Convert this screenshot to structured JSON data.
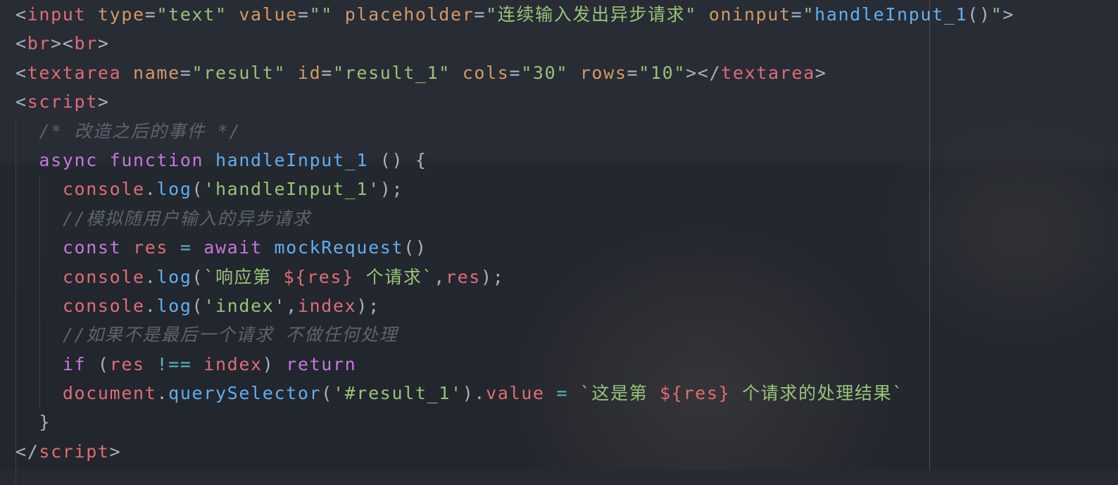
{
  "editor": {
    "colors": {
      "background": "#282c34",
      "tag": "#e06c75",
      "attribute": "#d19a66",
      "string": "#98c379",
      "keyword": "#c678dd",
      "function": "#61afef",
      "comment": "#5c6370",
      "punctuation": "#abb2bf",
      "operator": "#56b6c2"
    },
    "lines": [
      {
        "indent": 0,
        "tokens": [
          [
            "p",
            "<"
          ],
          [
            "t",
            "input"
          ],
          [
            "p",
            " "
          ],
          [
            "a",
            "type"
          ],
          [
            "p",
            "="
          ],
          [
            "s",
            "\"text\""
          ],
          [
            "p",
            " "
          ],
          [
            "a",
            "value"
          ],
          [
            "p",
            "="
          ],
          [
            "s",
            "\"\""
          ],
          [
            "p",
            " "
          ],
          [
            "a",
            "placeholder"
          ],
          [
            "p",
            "="
          ],
          [
            "s",
            "\"连续输入发出异步请求\""
          ],
          [
            "p",
            " "
          ],
          [
            "a",
            "oninput"
          ],
          [
            "p",
            "="
          ],
          [
            "s",
            "\""
          ],
          [
            "f",
            "handleInput_1"
          ],
          [
            "p",
            "()"
          ],
          [
            "s",
            "\""
          ],
          [
            "p",
            ">"
          ]
        ]
      },
      {
        "indent": 0,
        "tokens": [
          [
            "p",
            "<"
          ],
          [
            "t",
            "br"
          ],
          [
            "p",
            "><"
          ],
          [
            "t",
            "br"
          ],
          [
            "p",
            ">"
          ]
        ]
      },
      {
        "indent": 0,
        "tokens": [
          [
            "p",
            "<"
          ],
          [
            "t",
            "textarea"
          ],
          [
            "p",
            " "
          ],
          [
            "a",
            "name"
          ],
          [
            "p",
            "="
          ],
          [
            "s",
            "\"result\""
          ],
          [
            "p",
            " "
          ],
          [
            "a",
            "id"
          ],
          [
            "p",
            "="
          ],
          [
            "s",
            "\"result_1\""
          ],
          [
            "p",
            " "
          ],
          [
            "a",
            "cols"
          ],
          [
            "p",
            "="
          ],
          [
            "s",
            "\"30\""
          ],
          [
            "p",
            " "
          ],
          [
            "a",
            "rows"
          ],
          [
            "p",
            "="
          ],
          [
            "s",
            "\"10\""
          ],
          [
            "p",
            "></"
          ],
          [
            "t",
            "textarea"
          ],
          [
            "p",
            ">"
          ]
        ]
      },
      {
        "indent": 0,
        "tokens": [
          [
            "p",
            "<"
          ],
          [
            "t",
            "script"
          ],
          [
            "p",
            ">"
          ]
        ]
      },
      {
        "indent": 2,
        "tokens": [
          [
            "c",
            "/* 改造之后的事件 */"
          ]
        ]
      },
      {
        "indent": 2,
        "tokens": [
          [
            "k",
            "async"
          ],
          [
            "p",
            " "
          ],
          [
            "k",
            "function"
          ],
          [
            "p",
            " "
          ],
          [
            "f",
            "handleInput_1"
          ],
          [
            "p",
            " () {"
          ]
        ]
      },
      {
        "indent": 4,
        "tokens": [
          [
            "v",
            "console"
          ],
          [
            "p",
            "."
          ],
          [
            "f",
            "log"
          ],
          [
            "p",
            "("
          ],
          [
            "s",
            "'handleInput_1'"
          ],
          [
            "p",
            ");"
          ]
        ]
      },
      {
        "indent": 4,
        "tokens": [
          [
            "c",
            "//模拟随用户输入的异步请求"
          ]
        ]
      },
      {
        "indent": 4,
        "tokens": [
          [
            "k",
            "const"
          ],
          [
            "p",
            " "
          ],
          [
            "v",
            "res"
          ],
          [
            "p",
            " "
          ],
          [
            "o",
            "="
          ],
          [
            "p",
            " "
          ],
          [
            "k",
            "await"
          ],
          [
            "p",
            " "
          ],
          [
            "f",
            "mockRequest"
          ],
          [
            "p",
            "()"
          ]
        ]
      },
      {
        "indent": 4,
        "tokens": [
          [
            "v",
            "console"
          ],
          [
            "p",
            "."
          ],
          [
            "f",
            "log"
          ],
          [
            "p",
            "("
          ],
          [
            "s",
            "`响应第 "
          ],
          [
            "v",
            "${res}"
          ],
          [
            "s",
            " 个请求`"
          ],
          [
            "p",
            ","
          ],
          [
            "v",
            "res"
          ],
          [
            "p",
            ");"
          ]
        ]
      },
      {
        "indent": 4,
        "tokens": [
          [
            "v",
            "console"
          ],
          [
            "p",
            "."
          ],
          [
            "f",
            "log"
          ],
          [
            "p",
            "("
          ],
          [
            "s",
            "'index'"
          ],
          [
            "p",
            ","
          ],
          [
            "v",
            "index"
          ],
          [
            "p",
            ");"
          ]
        ]
      },
      {
        "indent": 4,
        "tokens": [
          [
            "c",
            "//如果不是最后一个请求 不做任何处理"
          ]
        ]
      },
      {
        "indent": 4,
        "tokens": [
          [
            "k",
            "if"
          ],
          [
            "p",
            " ("
          ],
          [
            "v",
            "res"
          ],
          [
            "p",
            " "
          ],
          [
            "o",
            "!=="
          ],
          [
            "p",
            " "
          ],
          [
            "v",
            "index"
          ],
          [
            "p",
            ") "
          ],
          [
            "k",
            "return"
          ]
        ]
      },
      {
        "indent": 4,
        "tokens": [
          [
            "v",
            "document"
          ],
          [
            "p",
            "."
          ],
          [
            "f",
            "querySelector"
          ],
          [
            "p",
            "("
          ],
          [
            "s",
            "'#result_1'"
          ],
          [
            "p",
            ")."
          ],
          [
            "v",
            "value"
          ],
          [
            "p",
            " "
          ],
          [
            "o",
            "="
          ],
          [
            "p",
            " "
          ],
          [
            "s",
            "`这是第 "
          ],
          [
            "v",
            "${res}"
          ],
          [
            "s",
            " 个请求的处理结果`"
          ]
        ]
      },
      {
        "indent": 2,
        "tokens": [
          [
            "p",
            "}"
          ]
        ]
      },
      {
        "indent": 0,
        "tokens": [
          [
            "p",
            "</"
          ],
          [
            "t",
            "script"
          ],
          [
            "p",
            ">"
          ]
        ]
      }
    ]
  }
}
